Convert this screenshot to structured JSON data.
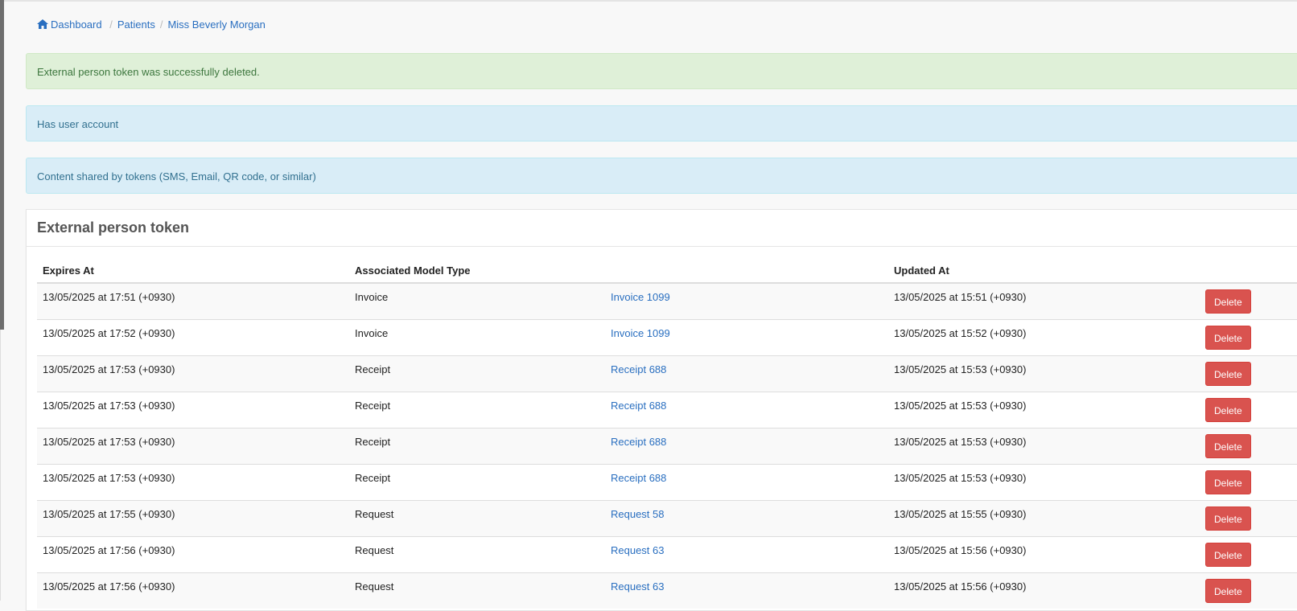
{
  "breadcrumb": {
    "home": "Dashboard",
    "patients": "Patients",
    "current": "Miss Beverly Morgan",
    "home_icon": "home-icon"
  },
  "alerts": {
    "success": "External person token was successfully deleted.",
    "user_account": "Has user account",
    "shared_content": "Content shared by tokens (SMS, Email, QR code, or similar)"
  },
  "panel": {
    "title": "External person token"
  },
  "table": {
    "headers": {
      "expires_at": "Expires At",
      "associated_model_type": "Associated Model Type",
      "link": "",
      "updated_at": "Updated At"
    },
    "rows": [
      {
        "expires_at": "13/05/2025 at 17:51 (+0930)",
        "type": "Invoice",
        "link": "Invoice 1099",
        "updated_at": "13/05/2025 at 15:51 (+0930)",
        "action": "Delete"
      },
      {
        "expires_at": "13/05/2025 at 17:52 (+0930)",
        "type": "Invoice",
        "link": "Invoice 1099",
        "updated_at": "13/05/2025 at 15:52 (+0930)",
        "action": "Delete"
      },
      {
        "expires_at": "13/05/2025 at 17:53 (+0930)",
        "type": "Receipt",
        "link": "Receipt 688",
        "updated_at": "13/05/2025 at 15:53 (+0930)",
        "action": "Delete"
      },
      {
        "expires_at": "13/05/2025 at 17:53 (+0930)",
        "type": "Receipt",
        "link": "Receipt 688",
        "updated_at": "13/05/2025 at 15:53 (+0930)",
        "action": "Delete"
      },
      {
        "expires_at": "13/05/2025 at 17:53 (+0930)",
        "type": "Receipt",
        "link": "Receipt 688",
        "updated_at": "13/05/2025 at 15:53 (+0930)",
        "action": "Delete"
      },
      {
        "expires_at": "13/05/2025 at 17:53 (+0930)",
        "type": "Receipt",
        "link": "Receipt 688",
        "updated_at": "13/05/2025 at 15:53 (+0930)",
        "action": "Delete"
      },
      {
        "expires_at": "13/05/2025 at 17:55 (+0930)",
        "type": "Request",
        "link": "Request 58",
        "updated_at": "13/05/2025 at 15:55 (+0930)",
        "action": "Delete"
      },
      {
        "expires_at": "13/05/2025 at 17:56 (+0930)",
        "type": "Request",
        "link": "Request 63",
        "updated_at": "13/05/2025 at 15:56 (+0930)",
        "action": "Delete"
      },
      {
        "expires_at": "13/05/2025 at 17:56 (+0930)",
        "type": "Request",
        "link": "Request 63",
        "updated_at": "13/05/2025 at 15:56 (+0930)",
        "action": "Delete"
      }
    ]
  },
  "colors": {
    "link": "#2a6fc0",
    "success_bg": "#dff0d8",
    "info_bg": "#d9edf7",
    "danger": "#d9534f"
  }
}
